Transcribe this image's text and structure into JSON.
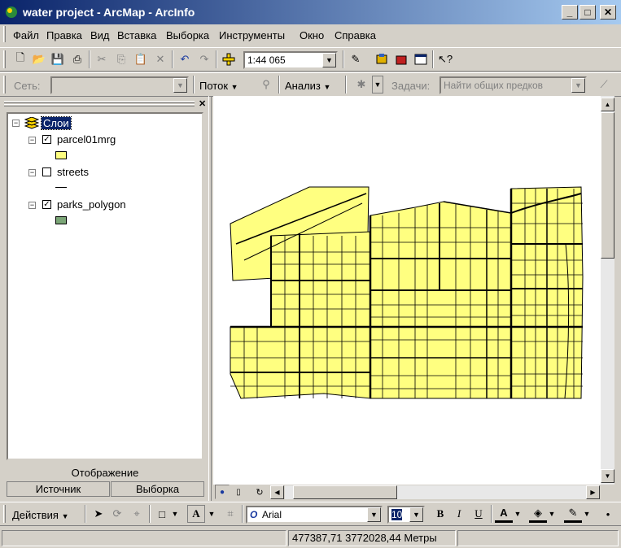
{
  "window": {
    "title": "water project - ArcMap - ArcInfo"
  },
  "menu": [
    "Файл",
    "Правка",
    "Вид",
    "Вставка",
    "Выборка",
    "Инструменты",
    "Окно",
    "Справка"
  ],
  "standard_toolbar": {
    "scale_value": "1:44 065"
  },
  "network_toolbar": {
    "network_label": "Сеть:",
    "flow_label": "Поток",
    "analysis_label": "Анализ",
    "tasks_label": "Задачи:",
    "tasks_value": "Найти общих предков"
  },
  "toc": {
    "root_label": "Слои",
    "layers": [
      {
        "name": "parcel01mrg",
        "checked": true,
        "symbol_color": "#ffff80"
      },
      {
        "name": "streets",
        "checked": false
      },
      {
        "name": "parks_polygon",
        "checked": true,
        "symbol_color": "#7ba677"
      }
    ],
    "tabs": {
      "display": "Отображение",
      "source": "Источник",
      "selection": "Выборка"
    }
  },
  "draw_toolbar": {
    "actions_label": "Действия",
    "font_name": "Arial",
    "font_size": "10"
  },
  "status": {
    "coordinates": "477387,71  3772028,44 Метры"
  },
  "colors": {
    "parcel_fill": "#ffff80",
    "title_start": "#0a246a",
    "title_end": "#a6caf0"
  }
}
